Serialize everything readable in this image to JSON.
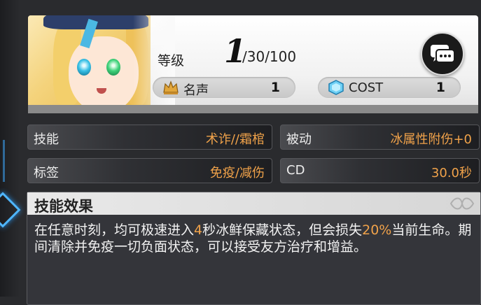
{
  "header": {
    "level_label": "等级",
    "level_value": "1",
    "level_max": "/30/100",
    "fame_label": "名声",
    "fame_value": "1",
    "cost_label": "COST",
    "cost_value": "1",
    "chat_icon": "chat-bubbles-icon"
  },
  "info": {
    "skill_key": "技能",
    "skill_value": "术诈//霜棺",
    "passive_key": "被动",
    "passive_value": "冰属性附伤+0",
    "tag_key": "标签",
    "tag_value": "免疫/减伤",
    "cd_key": "CD",
    "cd_value": "30.0秒"
  },
  "effect": {
    "title": "技能效果",
    "text_1": "在任意时刻，均可极速进入",
    "hl_1": "4",
    "text_2": "秒冰鲜保藏状态，但会损失",
    "hl_2": "20%",
    "text_3": "当前生命。期间清除并免疫一切负面状态，可以接受友方治疗和增益。"
  },
  "colors": {
    "accent_orange": "#f0a24a",
    "panel_dark": "#34353a",
    "highlight_blue": "#4fb6ff"
  }
}
